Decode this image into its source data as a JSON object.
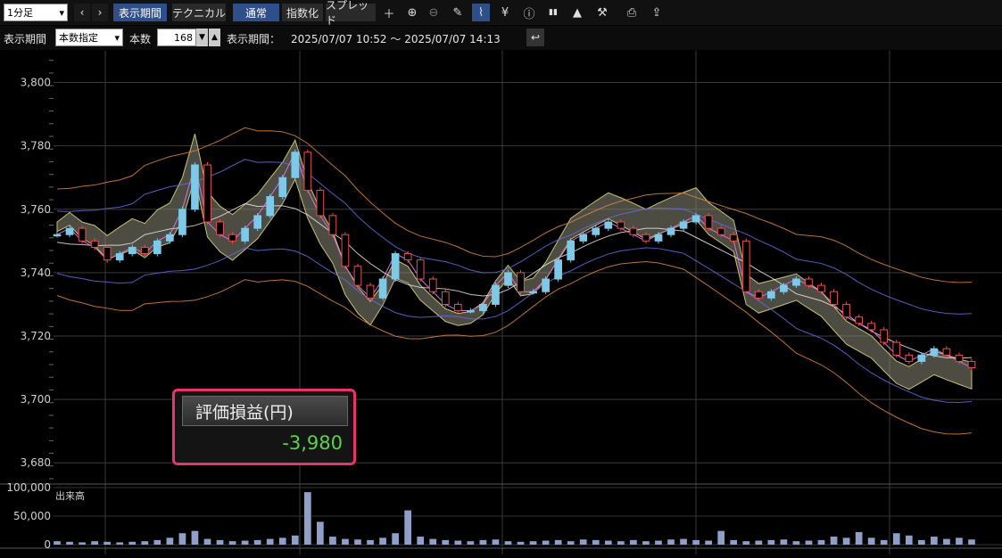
{
  "toolbar": {
    "interval": "1分足",
    "period_tab": "表示期間",
    "technical_tab": "テクニカル",
    "normal": "通常",
    "index": "指数化",
    "spread": "スプレッド"
  },
  "period_bar": {
    "label": "表示期間",
    "mode": "本数指定",
    "count_label": "本数",
    "count_value": "168",
    "range_label": "表示期間：",
    "range": "2025/07/07 10:52 〜 2025/07/07 14:13"
  },
  "popup": {
    "title": "評価損益(円)",
    "value": "-3,980"
  },
  "colors": {
    "price_candle_up": "#7ec8e8",
    "price_candle_down": "#e85050",
    "ichimoku_cloud": "#8a8a7a",
    "volume_bar": "#8fa0c8",
    "popup_border": "#e8336b",
    "pnl_value": "#5ad24a"
  },
  "chart_data": {
    "type": "line",
    "price_axis": {
      "ticks": [
        "3,800",
        "3,780",
        "3,760",
        "3,740",
        "3,720",
        "3,700",
        "3,680"
      ],
      "values": [
        3800,
        3780,
        3760,
        3740,
        3720,
        3700,
        3680
      ],
      "ylim": [
        3675,
        3810
      ]
    },
    "volume_axis": {
      "label": "出来高",
      "ticks": [
        "100,000",
        "50,000",
        "0"
      ],
      "values": [
        100000,
        50000,
        0
      ],
      "ylim": [
        0,
        100000
      ]
    },
    "grid": true,
    "series": [
      {
        "values": [
          3752,
          3754,
          3750,
          3748,
          3744,
          3746,
          3748,
          3746,
          3750,
          3752,
          3760,
          3774,
          3756,
          3752,
          3750,
          3754,
          3758,
          3764,
          3770,
          3778,
          3766,
          3758,
          3752,
          3742,
          3736,
          3732,
          3738,
          3746,
          3744,
          3738,
          3734,
          3730,
          3728,
          3728,
          3730,
          3736,
          3740,
          3734,
          3734,
          3738,
          3744,
          3750,
          3752,
          3754,
          3756,
          3754,
          3752,
          3750,
          3752,
          3754,
          3756,
          3758,
          3754,
          3752,
          3750,
          3734,
          3732,
          3734,
          3736,
          3738,
          3736,
          3734,
          3730,
          3726,
          3724,
          3722,
          3718,
          3714,
          3712,
          3714,
          3716,
          3714,
          3712,
          3710
        ]
      }
    ],
    "volume": [
      6,
      5,
      4,
      6,
      5,
      4,
      5,
      6,
      8,
      12,
      20,
      24,
      10,
      8,
      6,
      7,
      8,
      10,
      12,
      16,
      92,
      40,
      14,
      10,
      9,
      8,
      12,
      20,
      60,
      14,
      10,
      8,
      7,
      6,
      8,
      9,
      6,
      5,
      6,
      7,
      8,
      6,
      9,
      8,
      7,
      6,
      8,
      6,
      7,
      9,
      10,
      8,
      7,
      24,
      8,
      6,
      7,
      8,
      9,
      6,
      7,
      8,
      14,
      12,
      22,
      12,
      8,
      20,
      16,
      8,
      14,
      10,
      12,
      9
    ]
  }
}
